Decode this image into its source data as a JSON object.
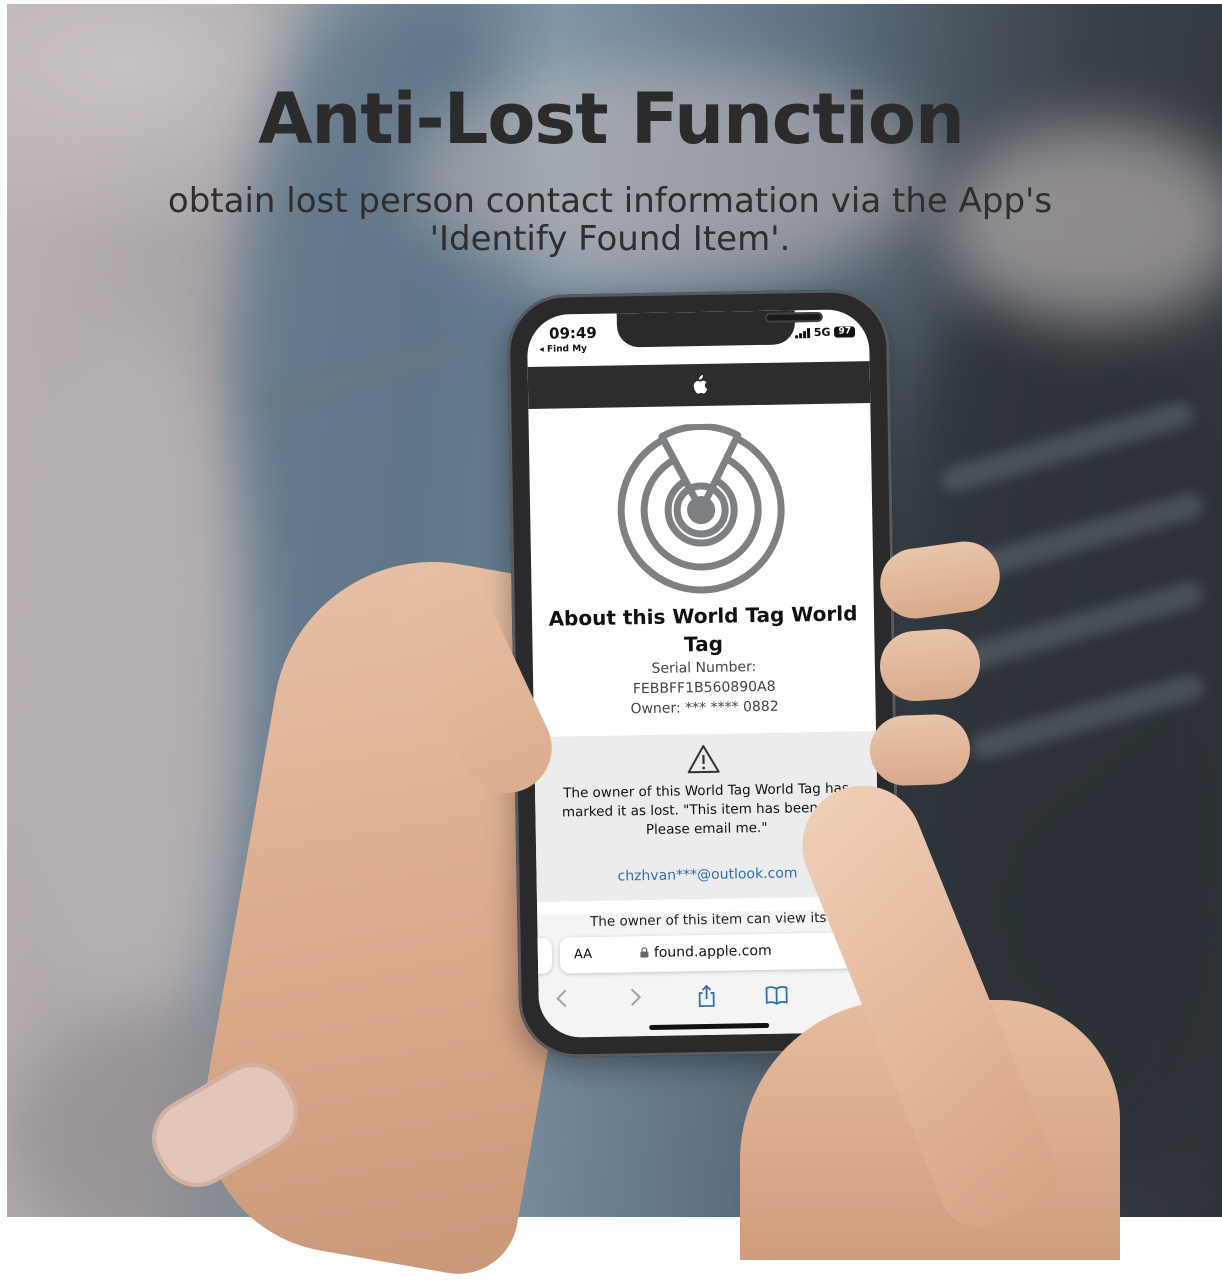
{
  "headline": "Anti-Lost Function",
  "subline": "obtain lost person contact information via the App's 'Identify Found Item'.",
  "phone": {
    "status_time": "09:49",
    "status_back": "◂ Find My",
    "network": "5G",
    "battery": "97",
    "about_title": "About this World Tag World Tag",
    "serial_label": "Serial Number:",
    "serial_value": "FEBBFF1B560890A8",
    "owner": "Owner: *** **** 0882",
    "lost_message": "The owner of this World Tag World Tag has marked it as lost. \"This item has been lost. Please email me.\"",
    "lost_email": "chzhvan***@outlook.com",
    "owner_view": "The owner of this item can view its",
    "url_aa": "AA",
    "url": "found.apple.com",
    "icons": [
      "apple-icon",
      "radar-icon",
      "warning-icon",
      "lock-icon",
      "back-icon",
      "forward-icon",
      "share-icon",
      "bookmarks-icon"
    ]
  },
  "colors": {
    "headline": "#2b2b2b",
    "link": "#2f6fb0",
    "dark_bar": "#2d2d2d"
  }
}
